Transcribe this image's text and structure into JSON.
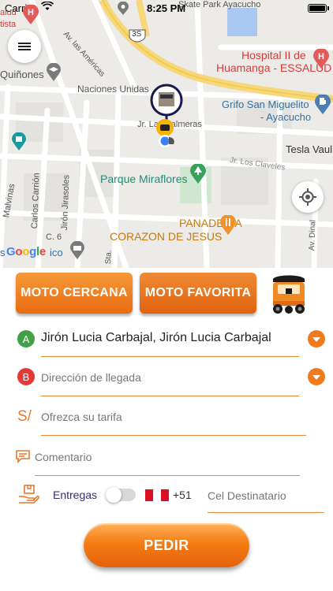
{
  "status_bar": {
    "carrier": "Carrier",
    "time": "8:25 PM"
  },
  "map": {
    "labels": {
      "skate_park": "Skate Park Ayacucho",
      "route": "3S",
      "av_americas": "Av. las Américas",
      "hospital_line1": "Hospital II de",
      "hospital_line2": "Huamanga - ESSALUD",
      "quinones": "Quiñones",
      "naciones_unidas": "Naciones Unidas",
      "las_palmeras": "Jr. Las Palmeras",
      "grifo_line1": "Grifo San Miguelito",
      "grifo_line2": "- Ayacucho",
      "tesla": "Tesla Vaul",
      "jr_los_claveles": "Jr. Los Claveles",
      "parque": "Parque Miraflores",
      "panaderia_line1": "PANADERIA",
      "panaderia_line2": "CORAZON DE JESUS",
      "carrion": "Carlos Carrión",
      "jirasoles": "Jirón Jirasoles",
      "malvinas": "Malvinas",
      "c6": "C. 6",
      "av_dinal": "Av. Dinal",
      "top_left_1": "alud",
      "top_left_2": "tista",
      "bottom_left": "s",
      "bottom_mid": "ico",
      "sta": "Sta."
    },
    "google": "Google"
  },
  "buttons": {
    "moto_cercana": "MOTO CERCANA",
    "moto_favorita": "MOTO FAVORITA",
    "pedir": "PEDIR"
  },
  "origin": {
    "marker": "A",
    "value": "Jirón Lucia Carbajal, Jirón Lucia Carbajal"
  },
  "destination": {
    "marker": "B",
    "placeholder": "Dirección de llegada"
  },
  "fare": {
    "currency": "S/",
    "placeholder": "Ofrezca su tarifa"
  },
  "comment": {
    "placeholder": "Comentario"
  },
  "delivery": {
    "label": "Entregas",
    "enabled": false,
    "country_code": "+51",
    "phone_placeholder": "Cel Destinatario"
  },
  "colors": {
    "accent": "#ee7b1e",
    "marker_a": "#43a047",
    "marker_b": "#e53935"
  }
}
